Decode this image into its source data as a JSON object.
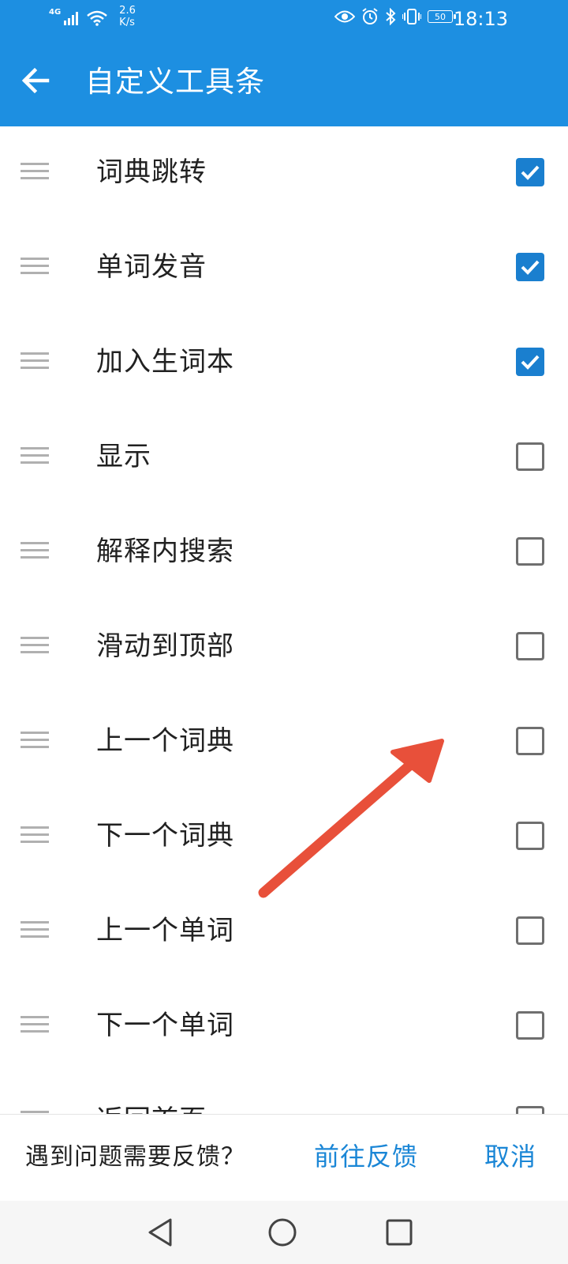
{
  "status_bar": {
    "network": "4G",
    "speed_value": "2.6",
    "speed_unit": "K/s",
    "battery": "50",
    "time": "18:13"
  },
  "app_bar": {
    "back_icon": "arrow-left-icon",
    "title": "自定义工具条"
  },
  "items": [
    {
      "label": "词典跳转",
      "checked": true
    },
    {
      "label": "单词发音",
      "checked": true
    },
    {
      "label": "加入生词本",
      "checked": true
    },
    {
      "label": "显示",
      "checked": false
    },
    {
      "label": "解释内搜索",
      "checked": false
    },
    {
      "label": "滑动到顶部",
      "checked": false
    },
    {
      "label": "上一个词典",
      "checked": false
    },
    {
      "label": "下一个词典",
      "checked": false
    },
    {
      "label": "上一个单词",
      "checked": false
    },
    {
      "label": "下一个单词",
      "checked": false
    },
    {
      "label": "返回首页",
      "checked": false
    }
  ],
  "bottom_bar": {
    "question": "遇到问题需要反馈？",
    "feedback_button": "前往反馈",
    "cancel_button": "取消"
  },
  "colors": {
    "accent": "#1d8fe1",
    "checkbox_on": "#1a7fcf",
    "annotation_arrow": "#e8503a"
  }
}
